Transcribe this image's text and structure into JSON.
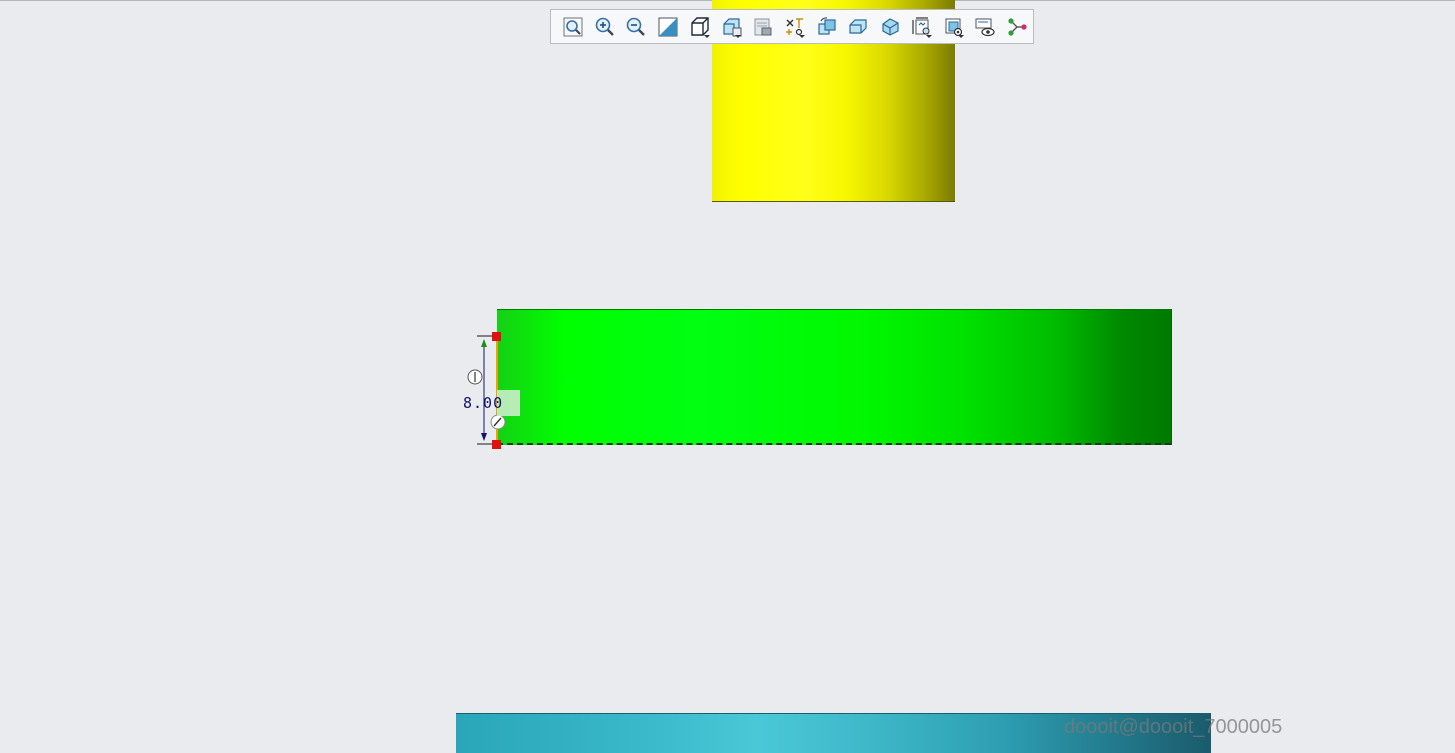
{
  "toolbar": {
    "buttons": [
      {
        "name": "refit",
        "icon": "magnify-fit-icon"
      },
      {
        "name": "zoom-in",
        "icon": "zoom-in-icon"
      },
      {
        "name": "zoom-out",
        "icon": "zoom-out-icon"
      },
      {
        "name": "repaint",
        "icon": "repaint-icon"
      },
      {
        "name": "display-style",
        "icon": "cube-display-style-icon",
        "has_dropdown": true
      },
      {
        "name": "saved-orientations",
        "icon": "saved-orientations-icon",
        "has_dropdown": true
      },
      {
        "name": "view-manager",
        "icon": "view-manager-icon"
      },
      {
        "name": "datum-display",
        "icon": "datum-display-icon",
        "has_dropdown": true
      },
      {
        "name": "spin-center",
        "icon": "spin-center-icon"
      },
      {
        "name": "annotation-display",
        "icon": "box-display-icon"
      },
      {
        "name": "sketch-view",
        "icon": "sketch-view-icon"
      },
      {
        "name": "sketcher-display",
        "icon": "sketcher-display-icon",
        "has_dropdown": true
      },
      {
        "name": "section-view",
        "icon": "section-view-icon",
        "has_dropdown": true
      },
      {
        "name": "layer-view",
        "icon": "eye-view-icon"
      },
      {
        "name": "references",
        "icon": "references-icon"
      }
    ]
  },
  "sketch": {
    "dimension_value": "8.00"
  },
  "colors": {
    "background": "#e9ebee",
    "yellow_part": "#ffff00",
    "green_part": "#00ff00",
    "teal_part": "#3bb8c9",
    "dimension": "#14146e",
    "vertex_marker": "#e01010"
  },
  "watermark": "doooit@doooit_7000005"
}
